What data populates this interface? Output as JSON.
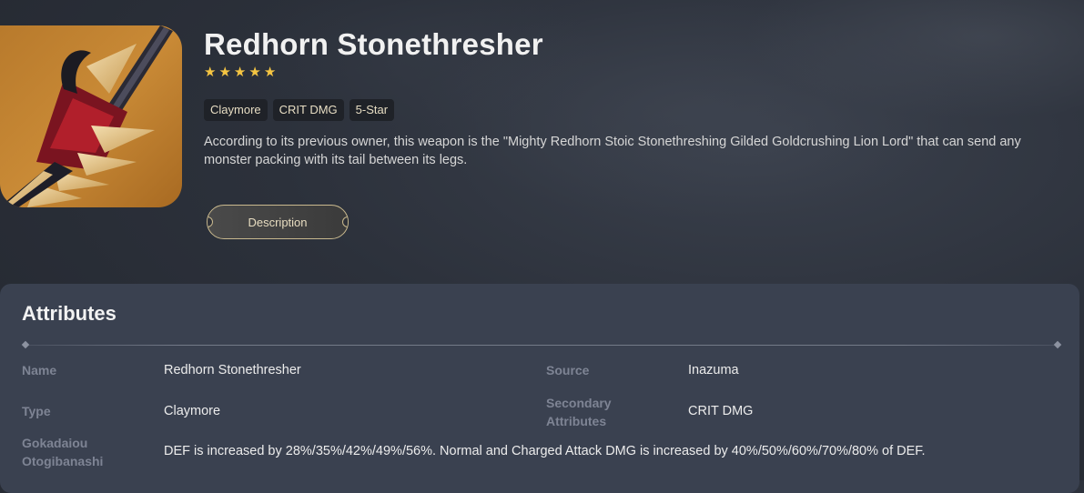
{
  "weapon": {
    "name": "Redhorn Stonethresher",
    "rarity_stars": 5,
    "star_glyphs": [
      "★",
      "★",
      "★",
      "★",
      "★"
    ],
    "tags": [
      "Claymore",
      "CRIT DMG",
      "5-Star"
    ],
    "description": "According to its previous owner, this weapon is the \"Mighty Redhorn Stoic Stonethreshing Gilded Goldcrushing Lion Lord\" that can send any monster packing with its tail between its legs.",
    "description_button": "Description",
    "art_icon": "claymore-weapon-art"
  },
  "attributes": {
    "title": "Attributes",
    "name_label": "Name",
    "name_value": "Redhorn Stonethresher",
    "source_label": "Source",
    "source_value": "Inazuma",
    "type_label": "Type",
    "type_value": "Claymore",
    "secondary_label_line1": "Secondary",
    "secondary_label_line2": "Attributes",
    "secondary_value": "CRIT DMG",
    "passive_label_line1": "Gokadaiou",
    "passive_label_line2": "Otogibanashi",
    "passive_value": "DEF is increased by 28%/35%/42%/49%/56%. Normal and Charged Attack DMG is increased by 40%/50%/60%/70%/80% of DEF."
  },
  "colors": {
    "star": "#f5c542",
    "accent_gold": "#c9b98e",
    "card_bg": "#3a4150",
    "label": "#7e8494"
  }
}
